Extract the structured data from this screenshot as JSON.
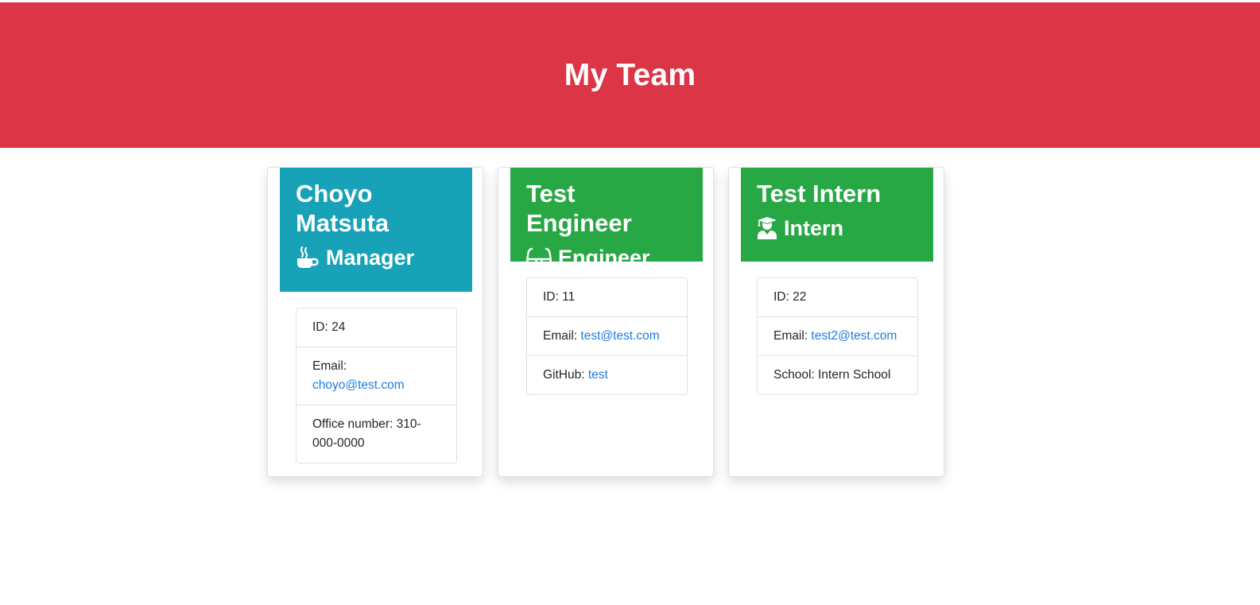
{
  "header": {
    "title": "My Team"
  },
  "colors": {
    "header_bg": "#dc3545",
    "manager_bg": "#17a2b8",
    "engineer_bg": "#28a745",
    "intern_bg": "#28a745",
    "link": "#1f7be3"
  },
  "cards": [
    {
      "name": "Choyo Matsuta",
      "role": "Manager",
      "icon": "coffee-mug-icon",
      "id_label": "ID: 24",
      "email_label": "Email:",
      "email": "choyo@test.com",
      "extra_label": "Office number: 310-000-0000"
    },
    {
      "name": "Test Engineer",
      "role": "Engineer",
      "icon": "glasses-icon",
      "id_label": "ID: 11",
      "email_label": "Email:",
      "email": "test@test.com",
      "extra_label": "GitHub:",
      "extra_link": "test"
    },
    {
      "name": "Test Intern",
      "role": "Intern",
      "icon": "graduate-icon",
      "id_label": "ID: 22",
      "email_label": "Email:",
      "email": "test2@test.com",
      "extra_label": "School: Intern School"
    }
  ]
}
